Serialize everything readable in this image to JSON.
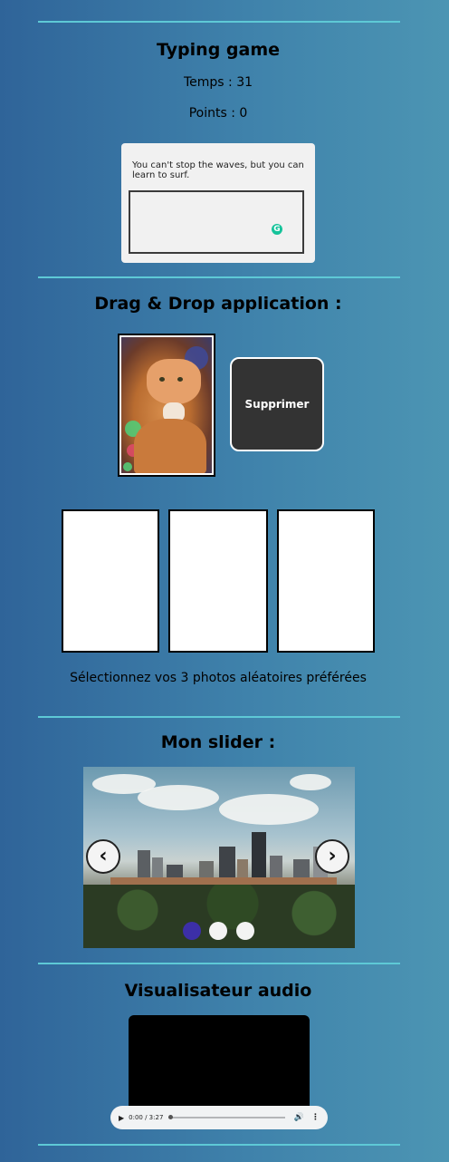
{
  "typing_game": {
    "title": "Typing game",
    "time_label": "Temps : 31",
    "points_label": "Points : 0",
    "sentence": "You can't stop the waves, but you can learn to surf.",
    "input_value": ""
  },
  "drag_drop": {
    "title": "Drag & Drop application :",
    "delete_label": "Supprimer",
    "caption": "Sélectionnez vos 3 photos aléatoires préférées"
  },
  "slider": {
    "title": "Mon slider :",
    "prev_icon": "‹",
    "next_icon": "›",
    "active_index": 0,
    "dot_count": 3
  },
  "audio": {
    "title": "Visualisateur audio",
    "current_time": "0:00 / 3:27",
    "progress": 0
  },
  "colors": {
    "divider": "#5ec9d6",
    "active_dot": "#3c2fa8",
    "grammar_icon": "#15c39a"
  }
}
